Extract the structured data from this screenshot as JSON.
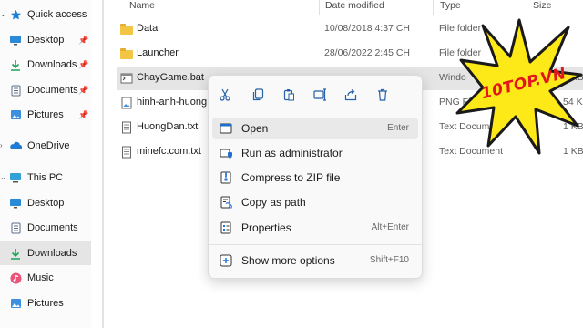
{
  "sidebar": {
    "items": [
      {
        "label": "Quick access",
        "icon": "star-icon",
        "pinned": false
      },
      {
        "label": "Desktop",
        "icon": "desktop-icon",
        "pinned": true
      },
      {
        "label": "Downloads",
        "icon": "download-icon",
        "pinned": true
      },
      {
        "label": "Documents",
        "icon": "documents-icon",
        "pinned": true
      },
      {
        "label": "Pictures",
        "icon": "pictures-icon",
        "pinned": true
      },
      {
        "label": "OneDrive",
        "icon": "cloud-icon",
        "pinned": false
      },
      {
        "label": "This PC",
        "icon": "computer-icon",
        "pinned": false
      },
      {
        "label": "Desktop",
        "icon": "desktop-icon",
        "pinned": false
      },
      {
        "label": "Documents",
        "icon": "documents-icon",
        "pinned": false
      },
      {
        "label": "Downloads",
        "icon": "download-icon",
        "pinned": false,
        "selected": true
      },
      {
        "label": "Music",
        "icon": "music-icon",
        "pinned": false
      },
      {
        "label": "Pictures",
        "icon": "pictures-icon",
        "pinned": false
      }
    ]
  },
  "columns": {
    "name": "Name",
    "date": "Date modified",
    "type": "Type",
    "size": "Size"
  },
  "files": [
    {
      "name": "Data",
      "date": "10/08/2018 4:37 CH",
      "type": "File folder",
      "size": "",
      "icon": "folder-icon"
    },
    {
      "name": "Launcher",
      "date": "28/06/2022 2:45 CH",
      "type": "File folder",
      "size": "",
      "icon": "folder-icon"
    },
    {
      "name": "ChayGame.bat",
      "date": "",
      "type": "Windo",
      "size": "1 KB",
      "icon": "bat-file-icon",
      "selected": true
    },
    {
      "name": "hinh-anh-huong",
      "date": "",
      "type": "PNG Fil",
      "size": "54 KB",
      "icon": "image-file-icon"
    },
    {
      "name": "HuongDan.txt",
      "date": "",
      "type": "Text Docum",
      "size": "1 KB",
      "icon": "text-file-icon"
    },
    {
      "name": "minefc.com.txt",
      "date": "",
      "type": "Text Document",
      "size": "1 KB",
      "icon": "text-file-icon"
    }
  ],
  "context_menu": {
    "toolbar": [
      {
        "icon": "cut-icon"
      },
      {
        "icon": "copy-icon"
      },
      {
        "icon": "paste-icon"
      },
      {
        "icon": "rename-icon"
      },
      {
        "icon": "share-icon"
      },
      {
        "icon": "delete-icon"
      }
    ],
    "items": [
      {
        "label": "Open",
        "shortcut": "Enter",
        "icon": "open-icon"
      },
      {
        "label": "Run as administrator",
        "shortcut": "",
        "icon": "shield-icon"
      },
      {
        "label": "Compress to ZIP file",
        "shortcut": "",
        "icon": "zip-icon"
      },
      {
        "label": "Copy as path",
        "shortcut": "",
        "icon": "copy-path-icon"
      },
      {
        "label": "Properties",
        "shortcut": "Alt+Enter",
        "icon": "properties-icon"
      },
      {
        "label": "Show more options",
        "shortcut": "Shift+F10",
        "icon": "more-options-icon"
      }
    ]
  },
  "watermark": {
    "text": "10TOP.VN"
  },
  "colors": {
    "accent": "#0078d4",
    "folder": "#f3c545",
    "badge_fill": "#fde818",
    "badge_text": "#e2161b",
    "selection": "#e5e5e5"
  }
}
